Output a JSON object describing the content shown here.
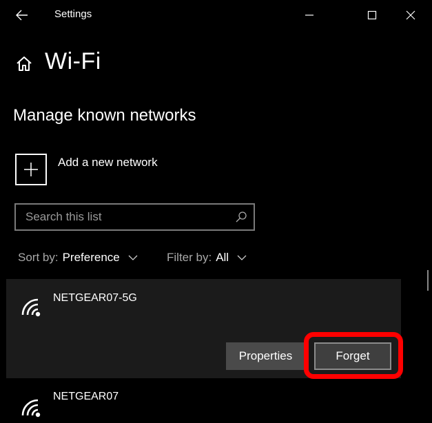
{
  "window": {
    "title": "Settings",
    "controls": {
      "minimize": "minimize-icon",
      "maximize": "maximize-icon",
      "close": "close-icon"
    },
    "back_icon": "back-arrow-icon"
  },
  "page": {
    "home_icon": "home-icon",
    "title": "Wi-Fi",
    "section_title": "Manage known networks"
  },
  "add_network": {
    "icon": "plus-icon",
    "label": "Add a new network"
  },
  "search": {
    "placeholder": "Search this list",
    "value": "",
    "icon": "search-icon"
  },
  "sort": {
    "label": "Sort by:",
    "value": "Preference"
  },
  "filter": {
    "label": "Filter by:",
    "value": "All"
  },
  "networks": [
    {
      "name": "NETGEAR07-5G",
      "icon": "wifi-icon",
      "selected": true,
      "actions": {
        "properties": "Properties",
        "forget": "Forget"
      }
    },
    {
      "name": "NETGEAR07",
      "icon": "wifi-icon",
      "selected": false
    }
  ],
  "annotation": {
    "highlight_color": "#ff0000",
    "target": "Forget"
  },
  "colors": {
    "background": "#000000",
    "selected_card": "#1b1b1b",
    "button": "#4a4a4a"
  }
}
